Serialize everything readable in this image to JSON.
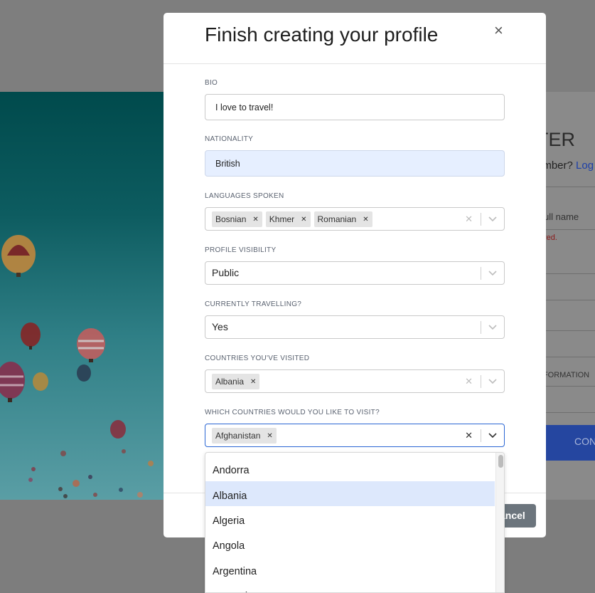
{
  "background": {
    "title_partial": "TER",
    "member_prompt_partial": "ember?",
    "login_link_partial": "Log",
    "fullname_partial": "ull name",
    "error_partial": "red.",
    "info_partial": "NFORMATION",
    "cta_partial": "CON"
  },
  "modal": {
    "title": "Finish creating your profile",
    "close_glyph": "×",
    "fields": {
      "bio": {
        "label": "BIO",
        "value": "I love to travel!"
      },
      "nationality": {
        "label": "NATIONALITY",
        "value": "British"
      },
      "languages": {
        "label": "LANGUAGES SPOKEN",
        "chips": [
          "Bosnian",
          "Khmer",
          "Romanian"
        ]
      },
      "visibility": {
        "label": "PROFILE VISIBILITY",
        "value": "Public"
      },
      "travelling": {
        "label": "CURRENTLY TRAVELLING?",
        "value": "Yes"
      },
      "visited": {
        "label": "COUNTRIES YOU'VE VISITED",
        "chips": [
          "Albania"
        ]
      },
      "wishlist": {
        "label": "WHICH COUNTRIES WOULD YOU LIKE TO VISIT?",
        "chips": [
          "Afghanistan"
        ]
      }
    },
    "cancel_partial": "ancel"
  },
  "dropdown": {
    "options": [
      "Andorra",
      "Albania",
      "Algeria",
      "Angola",
      "Argentina",
      "Antarctica"
    ],
    "highlighted": "Albania"
  },
  "colors": {
    "accent": "#2a66d4",
    "filled_bg": "#e6efff",
    "highlight": "#dde8fc",
    "cancel": "#6c757d"
  }
}
